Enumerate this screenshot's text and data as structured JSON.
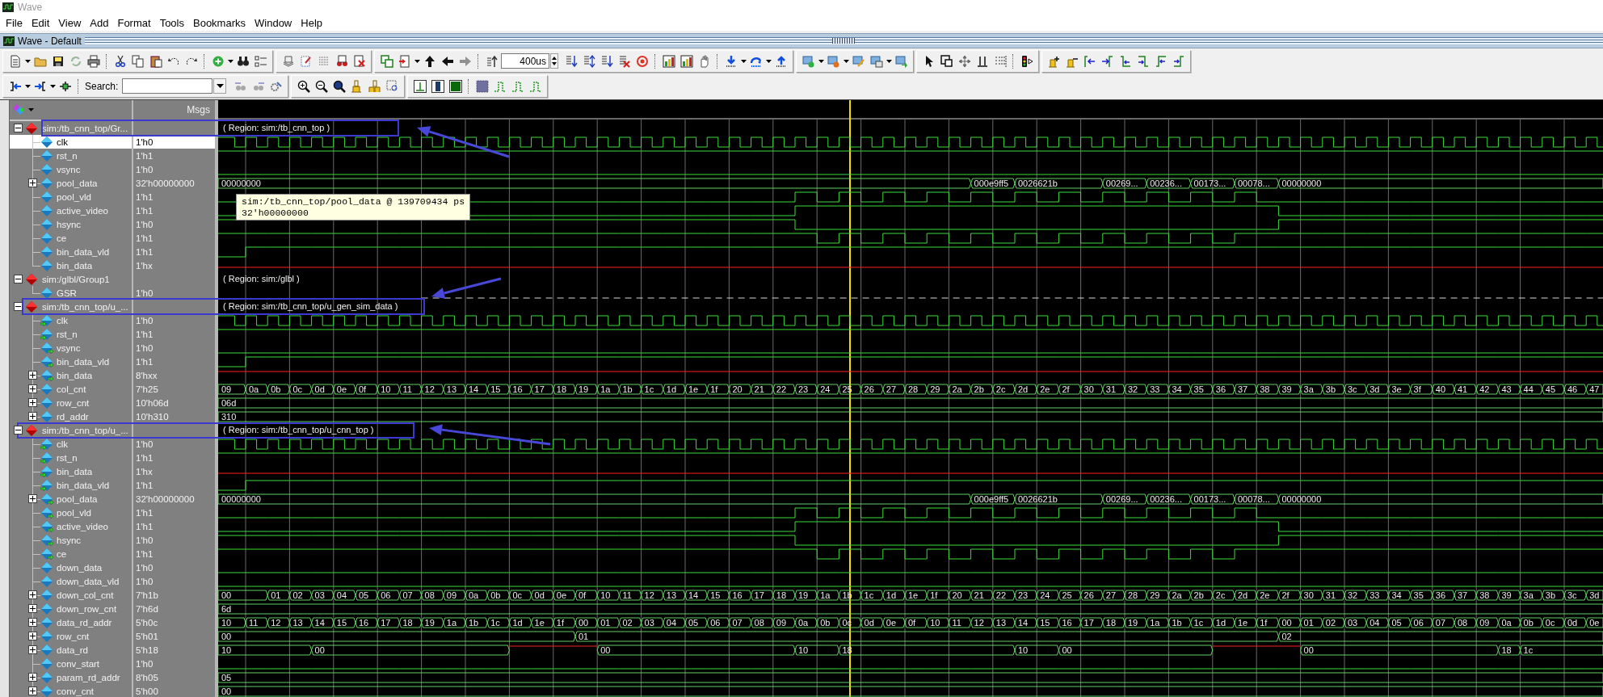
{
  "window": {
    "title": "Wave"
  },
  "menu": [
    "File",
    "Edit",
    "View",
    "Add",
    "Format",
    "Tools",
    "Bookmarks",
    "Window",
    "Help"
  ],
  "subwindow": {
    "title": "Wave - Default"
  },
  "toolbar": {
    "time_value": "400us",
    "search_label": "Search:"
  },
  "panel": {
    "messages_header": "Msgs"
  },
  "tooltip": {
    "lines": [
      "sim:/tb_cnn_top/pool_data @ 139709434 ps",
      "32'h00000000"
    ]
  },
  "groups": [
    {
      "name": "sim:/tb_cnn_top/Gr...",
      "region": "( Region: sim:/tb_cnn_top )",
      "expanded": true,
      "selected": false,
      "signals": [
        {
          "name": "clk",
          "value": "1'h0",
          "kind": "internal",
          "selected": true,
          "wave": {
            "kind": "clock"
          }
        },
        {
          "name": "rst_n",
          "value": "1'h1",
          "kind": "internal",
          "selected": false,
          "wave": {
            "kind": "high"
          }
        },
        {
          "name": "vsync",
          "value": "1'h0",
          "kind": "internal",
          "selected": false,
          "wave": {
            "kind": "low"
          }
        },
        {
          "name": "pool_data",
          "value": "32'h00000000",
          "kind": "internal",
          "selected": false,
          "expanded": false,
          "wave": {
            "kind": "burst-bus",
            "segments": [
              {
                "kind": "value",
                "label": "00000000"
              },
              {
                "kind": "value",
                "label": "000e9ff5"
              },
              {
                "kind": "value",
                "label": "0026621b"
              },
              {
                "kind": "value",
                "label": "00269..."
              },
              {
                "kind": "value",
                "label": "00236..."
              },
              {
                "kind": "value",
                "label": "00173..."
              },
              {
                "kind": "value",
                "label": "00078..."
              },
              {
                "kind": "value",
                "label": "00000000"
              }
            ]
          }
        },
        {
          "name": "pool_vld",
          "value": "1'h1",
          "kind": "internal",
          "selected": false,
          "wave": {
            "kind": "pulses"
          }
        },
        {
          "name": "active_video",
          "value": "1'h1",
          "kind": "internal",
          "selected": false,
          "wave": {
            "kind": "window"
          }
        },
        {
          "name": "hsync",
          "value": "1'h0",
          "kind": "internal",
          "selected": false,
          "wave": {
            "kind": "gap"
          }
        },
        {
          "name": "ce",
          "value": "1'h1",
          "kind": "internal",
          "selected": false,
          "wave": {
            "kind": "dips"
          }
        },
        {
          "name": "bin_data_vld",
          "value": "1'h1",
          "kind": "internal",
          "selected": false,
          "wave": {
            "kind": "rise"
          }
        },
        {
          "name": "bin_data",
          "value": "1'hx",
          "kind": "internal",
          "selected": false,
          "wave": {
            "kind": "unknown"
          }
        }
      ]
    },
    {
      "name": "sim:/glbl/Group1",
      "region": "( Region: sim:/glbl )",
      "expanded": true,
      "selected": false,
      "signals": [
        {
          "name": "GSR",
          "value": "1'h0",
          "kind": "internal",
          "selected": false,
          "wave": {
            "kind": "dashed"
          }
        }
      ]
    },
    {
      "name": "sim:/tb_cnn_top/u_...",
      "region": "( Region: sim:/tb_cnn_top/u_gen_sim_data )",
      "expanded": true,
      "selected": false,
      "signals": [
        {
          "name": "clk",
          "value": "1'h0",
          "kind": "input",
          "selected": false,
          "wave": {
            "kind": "clock"
          }
        },
        {
          "name": "rst_n",
          "value": "1'h1",
          "kind": "input",
          "selected": false,
          "wave": {
            "kind": "high"
          }
        },
        {
          "name": "vsync",
          "value": "1'h0",
          "kind": "output",
          "selected": false,
          "wave": {
            "kind": "low"
          }
        },
        {
          "name": "bin_data_vld",
          "value": "1'h1",
          "kind": "output",
          "selected": false,
          "wave": {
            "kind": "rise"
          }
        },
        {
          "name": "bin_data",
          "value": "8'hxx",
          "kind": "output",
          "selected": false,
          "expanded": false,
          "wave": {
            "kind": "constant-bus",
            "segments": [
              {
                "kind": "unknown"
              }
            ]
          }
        },
        {
          "name": "col_cnt",
          "value": "7'h25",
          "kind": "internal",
          "selected": false,
          "expanded": false,
          "wave": {
            "kind": "counter-bus",
            "segments": [
              {
                "kind": "value",
                "label": "09"
              },
              {
                "kind": "value",
                "label": "0a"
              },
              {
                "kind": "value",
                "label": "0b"
              },
              {
                "kind": "value",
                "label": "0c"
              },
              {
                "kind": "value",
                "label": "0d"
              },
              {
                "kind": "value",
                "label": "0e"
              },
              {
                "kind": "value",
                "label": "0f"
              },
              {
                "kind": "value",
                "label": "10"
              },
              {
                "kind": "value",
                "label": "11"
              },
              {
                "kind": "value",
                "label": "12"
              },
              {
                "kind": "value",
                "label": "13"
              },
              {
                "kind": "value",
                "label": "14"
              },
              {
                "kind": "value",
                "label": "15"
              },
              {
                "kind": "value",
                "label": "16"
              },
              {
                "kind": "value",
                "label": "17"
              },
              {
                "kind": "value",
                "label": "18"
              },
              {
                "kind": "value",
                "label": "19"
              },
              {
                "kind": "value",
                "label": "1a"
              },
              {
                "kind": "value",
                "label": "1b"
              },
              {
                "kind": "value",
                "label": "1c"
              },
              {
                "kind": "value",
                "label": "1d"
              },
              {
                "kind": "value",
                "label": "1e"
              },
              {
                "kind": "value",
                "label": "1f"
              },
              {
                "kind": "value",
                "label": "20"
              },
              {
                "kind": "value",
                "label": "21"
              },
              {
                "kind": "value",
                "label": "22"
              },
              {
                "kind": "value",
                "label": "23"
              },
              {
                "kind": "value",
                "label": "24"
              },
              {
                "kind": "value",
                "label": "25"
              },
              {
                "kind": "value",
                "label": "26"
              },
              {
                "kind": "value",
                "label": "27"
              },
              {
                "kind": "value",
                "label": "28"
              },
              {
                "kind": "value",
                "label": "29"
              },
              {
                "kind": "value",
                "label": "2a"
              },
              {
                "kind": "value",
                "label": "2b"
              },
              {
                "kind": "value",
                "label": "2c"
              },
              {
                "kind": "value",
                "label": "2d"
              },
              {
                "kind": "value",
                "label": "2e"
              },
              {
                "kind": "value",
                "label": "2f"
              },
              {
                "kind": "value",
                "label": "30"
              },
              {
                "kind": "value",
                "label": "31"
              },
              {
                "kind": "value",
                "label": "32"
              },
              {
                "kind": "value",
                "label": "33"
              },
              {
                "kind": "value",
                "label": "34"
              },
              {
                "kind": "value",
                "label": "35"
              },
              {
                "kind": "value",
                "label": "36"
              },
              {
                "kind": "value",
                "label": "37"
              },
              {
                "kind": "value",
                "label": "38"
              },
              {
                "kind": "value",
                "label": "39"
              },
              {
                "kind": "value",
                "label": "3a"
              },
              {
                "kind": "value",
                "label": "3b"
              },
              {
                "kind": "value",
                "label": "3c"
              },
              {
                "kind": "value",
                "label": "3d"
              },
              {
                "kind": "value",
                "label": "3e"
              },
              {
                "kind": "value",
                "label": "3f"
              },
              {
                "kind": "value",
                "label": "40"
              },
              {
                "kind": "value",
                "label": "41"
              },
              {
                "kind": "value",
                "label": "42"
              },
              {
                "kind": "value",
                "label": "43"
              },
              {
                "kind": "value",
                "label": "44"
              },
              {
                "kind": "value",
                "label": "45"
              },
              {
                "kind": "value",
                "label": "46"
              },
              {
                "kind": "value",
                "label": "47"
              }
            ]
          }
        },
        {
          "name": "row_cnt",
          "value": "10'h06d",
          "kind": "internal",
          "selected": false,
          "expanded": false,
          "wave": {
            "kind": "constant-bus",
            "segments": [
              {
                "kind": "value",
                "label": "06d"
              }
            ]
          }
        },
        {
          "name": "rd_addr",
          "value": "10'h310",
          "kind": "internal",
          "selected": false,
          "expanded": false,
          "wave": {
            "kind": "constant-bus",
            "segments": [
              {
                "kind": "value",
                "label": "310"
              }
            ]
          }
        }
      ]
    },
    {
      "name": "sim:/tb_cnn_top/u_...",
      "region": "( Region: sim:/tb_cnn_top/u_cnn_top )",
      "expanded": true,
      "selected": false,
      "signals": [
        {
          "name": "clk",
          "value": "1'h0",
          "kind": "input",
          "selected": false,
          "wave": {
            "kind": "clock"
          }
        },
        {
          "name": "rst_n",
          "value": "1'h1",
          "kind": "input",
          "selected": false,
          "wave": {
            "kind": "high"
          }
        },
        {
          "name": "bin_data",
          "value": "1'hx",
          "kind": "input",
          "selected": false,
          "wave": {
            "kind": "unknown"
          }
        },
        {
          "name": "bin_data_vld",
          "value": "1'h1",
          "kind": "input",
          "selected": false,
          "wave": {
            "kind": "rise"
          }
        },
        {
          "name": "pool_data",
          "value": "32'h00000000",
          "kind": "output",
          "selected": false,
          "expanded": false,
          "wave": {
            "kind": "burst-bus",
            "segments": [
              {
                "kind": "value",
                "label": "00000000"
              },
              {
                "kind": "value",
                "label": "000e9ff5"
              },
              {
                "kind": "value",
                "label": "0026621b"
              },
              {
                "kind": "value",
                "label": "00269..."
              },
              {
                "kind": "value",
                "label": "00236..."
              },
              {
                "kind": "value",
                "label": "00173..."
              },
              {
                "kind": "value",
                "label": "00078..."
              },
              {
                "kind": "value",
                "label": "00000000"
              }
            ]
          }
        },
        {
          "name": "pool_vld",
          "value": "1'h1",
          "kind": "output",
          "selected": false,
          "wave": {
            "kind": "pulses"
          }
        },
        {
          "name": "active_video",
          "value": "1'h1",
          "kind": "output",
          "selected": false,
          "wave": {
            "kind": "window"
          }
        },
        {
          "name": "hsync",
          "value": "1'h0",
          "kind": "output",
          "selected": false,
          "wave": {
            "kind": "gap"
          }
        },
        {
          "name": "ce",
          "value": "1'h1",
          "kind": "output",
          "selected": false,
          "wave": {
            "kind": "dips"
          }
        },
        {
          "name": "down_data",
          "value": "1'h0",
          "kind": "internal",
          "selected": false,
          "wave": {
            "kind": "low"
          }
        },
        {
          "name": "down_data_vld",
          "value": "1'h0",
          "kind": "internal",
          "selected": false,
          "wave": {
            "kind": "low"
          }
        },
        {
          "name": "down_col_cnt",
          "value": "7'h1b",
          "kind": "internal",
          "selected": false,
          "expanded": false,
          "wave": {
            "kind": "late-counter-bus",
            "segments": [
              {
                "kind": "value",
                "label": "00"
              },
              {
                "kind": "value",
                "label": "01"
              },
              {
                "kind": "value",
                "label": "02"
              },
              {
                "kind": "value",
                "label": "03"
              },
              {
                "kind": "value",
                "label": "04"
              },
              {
                "kind": "value",
                "label": "05"
              },
              {
                "kind": "value",
                "label": "06"
              },
              {
                "kind": "value",
                "label": "07"
              },
              {
                "kind": "value",
                "label": "08"
              },
              {
                "kind": "value",
                "label": "09"
              },
              {
                "kind": "value",
                "label": "0a"
              },
              {
                "kind": "value",
                "label": "0b"
              },
              {
                "kind": "value",
                "label": "0c"
              },
              {
                "kind": "value",
                "label": "0d"
              },
              {
                "kind": "value",
                "label": "0e"
              },
              {
                "kind": "value",
                "label": "0f"
              },
              {
                "kind": "value",
                "label": "10"
              },
              {
                "kind": "value",
                "label": "11"
              },
              {
                "kind": "value",
                "label": "12"
              },
              {
                "kind": "value",
                "label": "13"
              },
              {
                "kind": "value",
                "label": "14"
              },
              {
                "kind": "value",
                "label": "15"
              },
              {
                "kind": "value",
                "label": "16"
              },
              {
                "kind": "value",
                "label": "17"
              },
              {
                "kind": "value",
                "label": "18"
              },
              {
                "kind": "value",
                "label": "19"
              },
              {
                "kind": "value",
                "label": "1a"
              },
              {
                "kind": "value",
                "label": "1b"
              },
              {
                "kind": "value",
                "label": "1c"
              },
              {
                "kind": "value",
                "label": "1d"
              },
              {
                "kind": "value",
                "label": "1e"
              },
              {
                "kind": "value",
                "label": "1f"
              },
              {
                "kind": "value",
                "label": "20"
              },
              {
                "kind": "value",
                "label": "21"
              },
              {
                "kind": "value",
                "label": "22"
              },
              {
                "kind": "value",
                "label": "23"
              },
              {
                "kind": "value",
                "label": "24"
              },
              {
                "kind": "value",
                "label": "25"
              },
              {
                "kind": "value",
                "label": "26"
              },
              {
                "kind": "value",
                "label": "27"
              },
              {
                "kind": "value",
                "label": "28"
              },
              {
                "kind": "value",
                "label": "29"
              },
              {
                "kind": "value",
                "label": "2a"
              },
              {
                "kind": "value",
                "label": "2b"
              },
              {
                "kind": "value",
                "label": "2c"
              },
              {
                "kind": "value",
                "label": "2d"
              },
              {
                "kind": "value",
                "label": "2e"
              },
              {
                "kind": "value",
                "label": "2f"
              },
              {
                "kind": "value",
                "label": "30"
              },
              {
                "kind": "value",
                "label": "31"
              },
              {
                "kind": "value",
                "label": "32"
              },
              {
                "kind": "value",
                "label": "33"
              },
              {
                "kind": "value",
                "label": "34"
              },
              {
                "kind": "value",
                "label": "35"
              },
              {
                "kind": "value",
                "label": "36"
              },
              {
                "kind": "value",
                "label": "37"
              },
              {
                "kind": "value",
                "label": "38"
              },
              {
                "kind": "value",
                "label": "39"
              },
              {
                "kind": "value",
                "label": "3a"
              },
              {
                "kind": "value",
                "label": "3b"
              },
              {
                "kind": "value",
                "label": "3c"
              },
              {
                "kind": "value",
                "label": "3d"
              }
            ]
          }
        },
        {
          "name": "down_row_cnt",
          "value": "7'h6d",
          "kind": "internal",
          "selected": false,
          "expanded": false,
          "wave": {
            "kind": "constant-bus",
            "segments": [
              {
                "kind": "value",
                "label": "6d"
              }
            ]
          }
        },
        {
          "name": "data_rd_addr",
          "value": "5'h0c",
          "kind": "internal",
          "selected": false,
          "expanded": false,
          "wave": {
            "kind": "counter-bus",
            "segments": [
              {
                "kind": "value",
                "label": "10"
              },
              {
                "kind": "value",
                "label": "11"
              },
              {
                "kind": "value",
                "label": "12"
              },
              {
                "kind": "value",
                "label": "13"
              },
              {
                "kind": "value",
                "label": "14"
              },
              {
                "kind": "value",
                "label": "15"
              },
              {
                "kind": "value",
                "label": "16"
              },
              {
                "kind": "value",
                "label": "17"
              },
              {
                "kind": "value",
                "label": "18"
              },
              {
                "kind": "value",
                "label": "19"
              },
              {
                "kind": "value",
                "label": "1a"
              },
              {
                "kind": "value",
                "label": "1b"
              },
              {
                "kind": "value",
                "label": "1c"
              },
              {
                "kind": "value",
                "label": "1d"
              },
              {
                "kind": "value",
                "label": "1e"
              },
              {
                "kind": "value",
                "label": "1f"
              },
              {
                "kind": "value",
                "label": "00"
              },
              {
                "kind": "value",
                "label": "01"
              },
              {
                "kind": "value",
                "label": "02"
              },
              {
                "kind": "value",
                "label": "03"
              },
              {
                "kind": "value",
                "label": "04"
              },
              {
                "kind": "value",
                "label": "05"
              },
              {
                "kind": "value",
                "label": "06"
              },
              {
                "kind": "value",
                "label": "07"
              },
              {
                "kind": "value",
                "label": "08"
              },
              {
                "kind": "value",
                "label": "09"
              },
              {
                "kind": "value",
                "label": "0a"
              },
              {
                "kind": "value",
                "label": "0b"
              },
              {
                "kind": "value",
                "label": "0c"
              },
              {
                "kind": "value",
                "label": "0d"
              },
              {
                "kind": "value",
                "label": "0e"
              },
              {
                "kind": "value",
                "label": "0f"
              },
              {
                "kind": "value",
                "label": "10"
              },
              {
                "kind": "value",
                "label": "11"
              },
              {
                "kind": "value",
                "label": "12"
              },
              {
                "kind": "value",
                "label": "13"
              },
              {
                "kind": "value",
                "label": "14"
              },
              {
                "kind": "value",
                "label": "15"
              },
              {
                "kind": "value",
                "label": "16"
              },
              {
                "kind": "value",
                "label": "17"
              },
              {
                "kind": "value",
                "label": "18"
              },
              {
                "kind": "value",
                "label": "19"
              },
              {
                "kind": "value",
                "label": "1a"
              },
              {
                "kind": "value",
                "label": "1b"
              },
              {
                "kind": "value",
                "label": "1c"
              },
              {
                "kind": "value",
                "label": "1d"
              },
              {
                "kind": "value",
                "label": "1e"
              },
              {
                "kind": "value",
                "label": "1f"
              },
              {
                "kind": "value",
                "label": "00"
              },
              {
                "kind": "value",
                "label": "01"
              },
              {
                "kind": "value",
                "label": "02"
              },
              {
                "kind": "value",
                "label": "03"
              },
              {
                "kind": "value",
                "label": "04"
              },
              {
                "kind": "value",
                "label": "05"
              },
              {
                "kind": "value",
                "label": "06"
              },
              {
                "kind": "value",
                "label": "07"
              },
              {
                "kind": "value",
                "label": "08"
              },
              {
                "kind": "value",
                "label": "09"
              },
              {
                "kind": "value",
                "label": "0a"
              },
              {
                "kind": "value",
                "label": "0b"
              },
              {
                "kind": "value",
                "label": "0c"
              },
              {
                "kind": "value",
                "label": "0d"
              },
              {
                "kind": "value",
                "label": "0e"
              }
            ]
          }
        },
        {
          "name": "row_cnt",
          "value": "5'h01",
          "kind": "internal",
          "selected": false,
          "expanded": false,
          "wave": {
            "kind": "steps-bus",
            "segments": [
              {
                "kind": "value",
                "label": "00"
              },
              {
                "kind": "value",
                "label": "01"
              },
              {
                "kind": "value",
                "label": "02"
              }
            ]
          }
        },
        {
          "name": "data_rd",
          "value": "5'h18",
          "kind": "internal",
          "selected": false,
          "expanded": false,
          "wave": {
            "kind": "reads-bus",
            "segments": [
              {
                "kind": "value",
                "label": "10"
              },
              {
                "kind": "value",
                "label": "00"
              },
              {
                "kind": "unknown"
              },
              {
                "kind": "value",
                "label": "00"
              },
              {
                "kind": "value",
                "label": "10"
              },
              {
                "kind": "value",
                "label": "18"
              },
              {
                "kind": "value",
                "label": "10"
              },
              {
                "kind": "value",
                "label": "00"
              },
              {
                "kind": "unknown"
              },
              {
                "kind": "value",
                "label": "00"
              },
              {
                "kind": "value",
                "label": "18"
              },
              {
                "kind": "value",
                "label": "1c"
              }
            ]
          }
        },
        {
          "name": "conv_start",
          "value": "1'h0",
          "kind": "internal",
          "selected": false,
          "wave": {
            "kind": "low"
          }
        },
        {
          "name": "param_rd_addr",
          "value": "8'h05",
          "kind": "internal",
          "selected": false,
          "expanded": false,
          "wave": {
            "kind": "constant-bus",
            "segments": [
              {
                "kind": "value",
                "label": "05"
              }
            ]
          }
        },
        {
          "name": "conv_cnt",
          "value": "5'h00",
          "kind": "internal",
          "selected": false,
          "expanded": false,
          "wave": {
            "kind": "constant-bus",
            "segments": [
              {
                "kind": "value",
                "label": "00"
              }
            ]
          }
        }
      ]
    }
  ]
}
